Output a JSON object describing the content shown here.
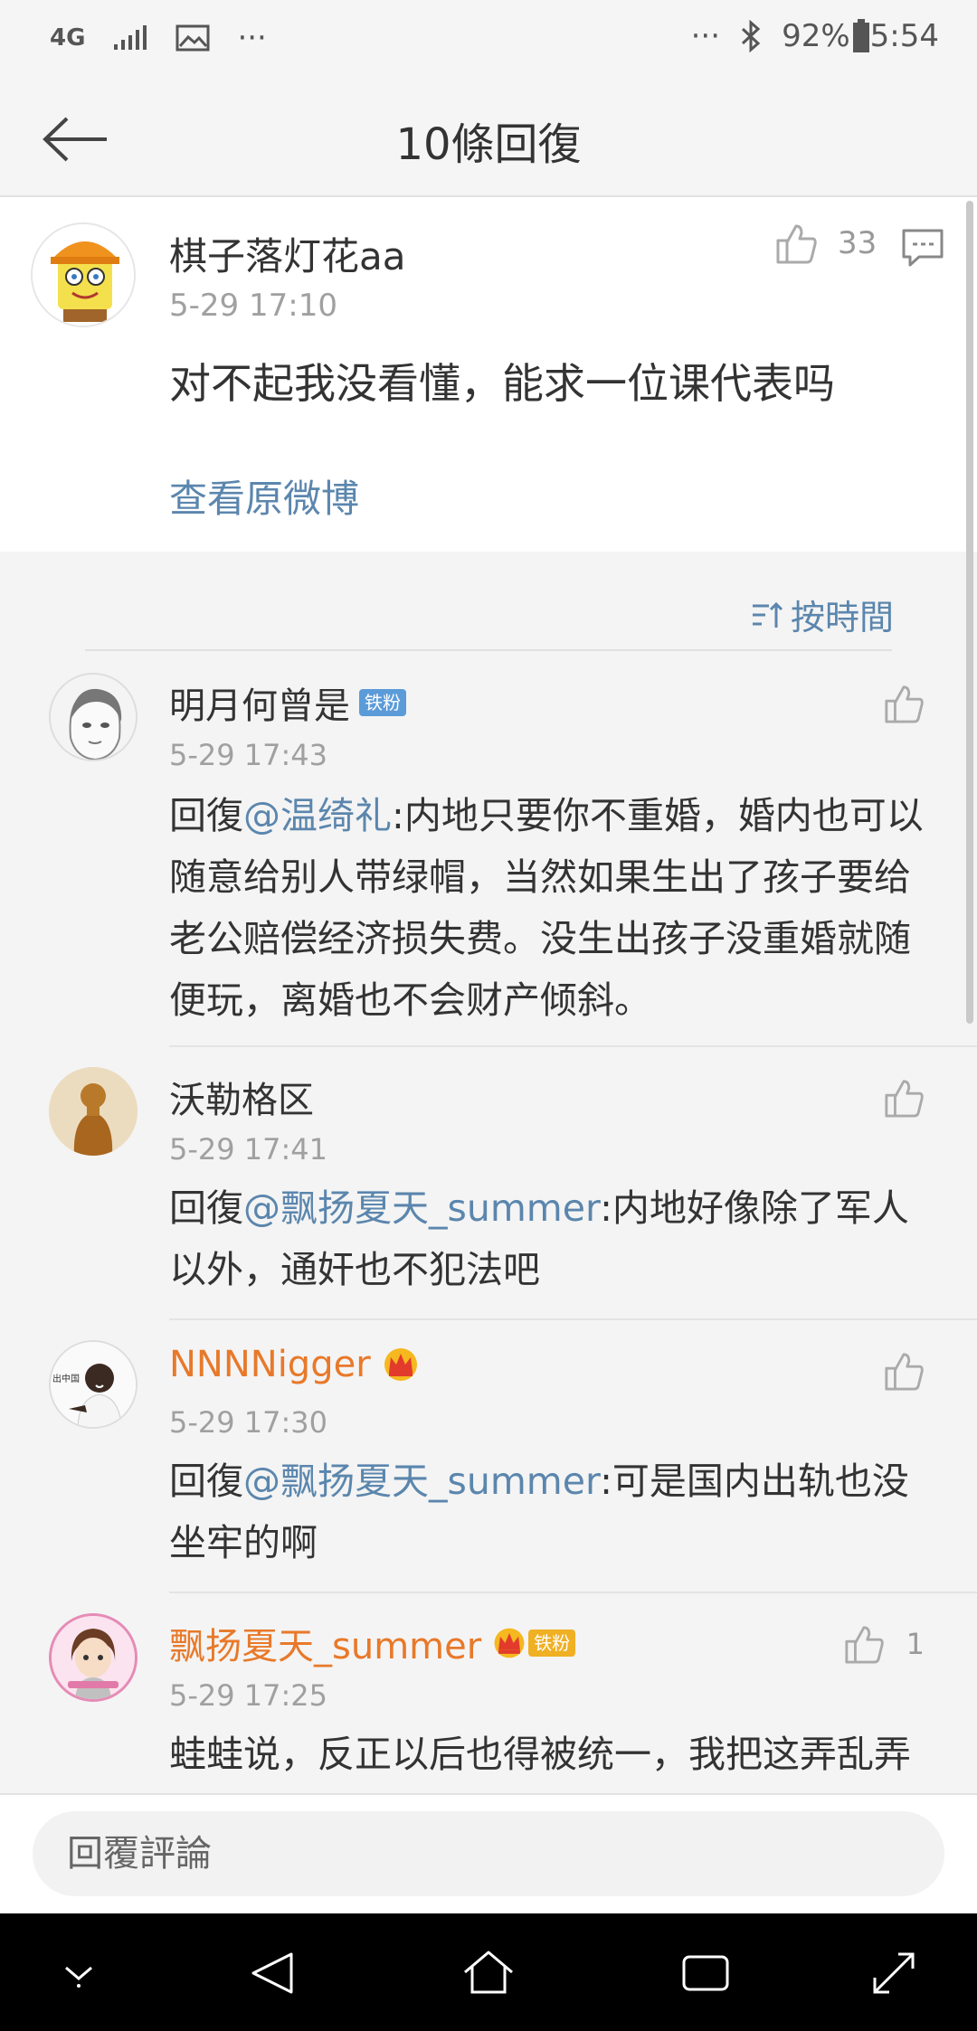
{
  "status_bar": {
    "network": "4G",
    "overflow": "···",
    "overflow_right": "···",
    "battery": "92%",
    "time": "5:54",
    "icons": [
      "network-4g-icon",
      "signal-icon",
      "gallery-icon",
      "bluetooth-icon",
      "battery-icon"
    ]
  },
  "header": {
    "title": "10條回復",
    "back_icon": "back-arrow-icon"
  },
  "original_comment": {
    "username": "棋子落灯花aa",
    "time": "5-29 17:10",
    "text": "对不起我没看懂，能求一位课代表吗",
    "likes": "33",
    "view_original": "查看原微博"
  },
  "sort": {
    "label": "按時間",
    "icon": "sort-icon"
  },
  "replies": [
    {
      "username": "明月何曾是",
      "badge": "铁粉",
      "time": "5-29 17:43",
      "prefix": "回復",
      "mention": "@温绮礼",
      "body": ":内地只要你不重婚，婚内也可以随意给别人带绿帽，当然如果生出了孩子要给老公赔偿经济损失费。没生出孩子没重婚就随便玩，离婚也不会财产倾斜。",
      "likes": ""
    },
    {
      "username": "沃勒格区",
      "badge": "",
      "time": "5-29 17:41",
      "prefix": "回復",
      "mention": "@飘扬夏天_summer",
      "body": ":内地好像除了军人以外，通奸也不犯法吧",
      "likes": ""
    },
    {
      "username": "NNNNigger",
      "badge": "",
      "time": "5-29 17:30",
      "prefix": "回復",
      "mention": "@飘扬夏天_summer",
      "body": ":可是国内出轨也没坐牢的啊",
      "likes": "",
      "avatar_text": "出中国"
    },
    {
      "username": "飘扬夏天_summer",
      "badge": "铁粉",
      "time": "5-29 17:25",
      "prefix": "",
      "mention": "",
      "body": "蛙蛙说，反正以后也得被统一，我把这弄乱弄",
      "likes": "1"
    }
  ],
  "input": {
    "placeholder": "回覆評論"
  },
  "colors": {
    "link": "#5b86ad",
    "vip_name": "#e8792a",
    "fan_badge": "#5b9bd8",
    "gold_badge": "#f0b024"
  }
}
